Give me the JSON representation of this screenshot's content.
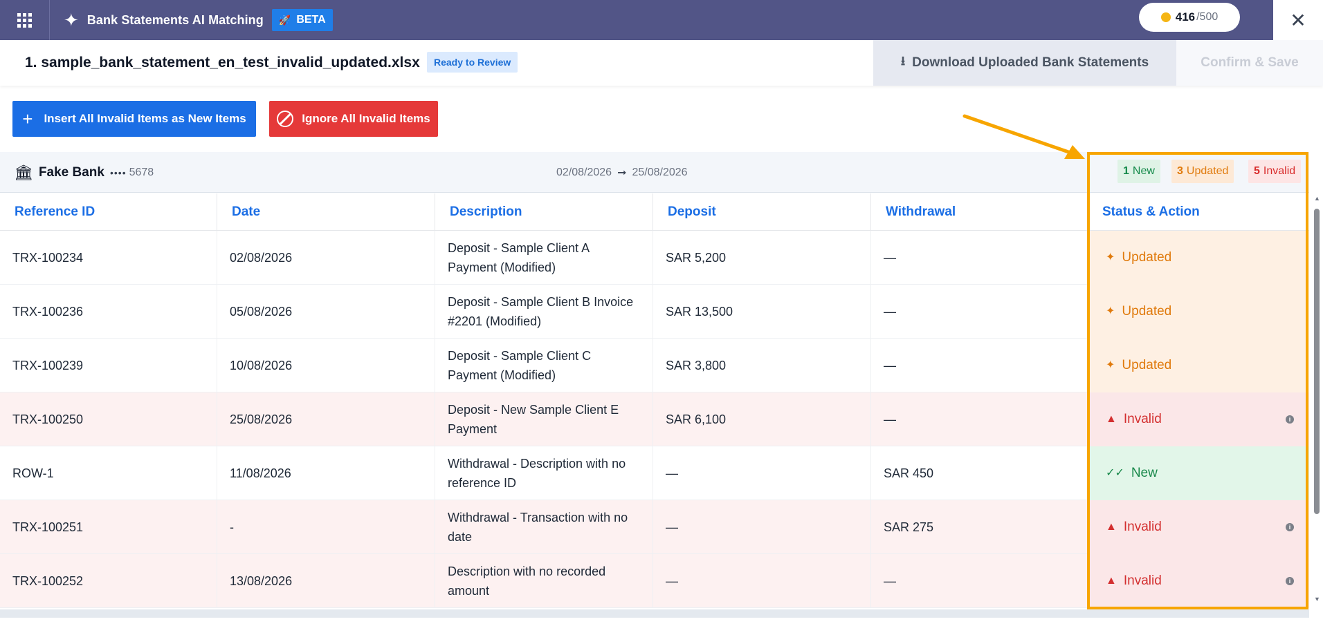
{
  "topbar": {
    "app_title": "Bank Statements AI Matching",
    "beta_label": "BETA",
    "credits_used": "416",
    "credits_total": "/500",
    "apps_icon": "apps-grid-icon",
    "close_icon": "close-icon"
  },
  "file_header": {
    "file_name": "1. sample_bank_statement_en_test_invalid_updated.xlsx",
    "status_badge": "Ready to Review",
    "download_label": "Download Uploaded Bank Statements",
    "confirm_label": "Confirm & Save"
  },
  "actions": {
    "insert_label": "Insert All Invalid Items as New Items",
    "ignore_label": "Ignore All Invalid Items"
  },
  "bank": {
    "name": "Fake Bank",
    "dots": "••••",
    "account": "5678",
    "date_from": "02/08/2026",
    "date_to": "25/08/2026",
    "new_count": "1",
    "new_label": "New",
    "updated_count": "3",
    "updated_label": "Updated",
    "invalid_count": "5",
    "invalid_label": "Invalid"
  },
  "table": {
    "headers": [
      "Reference ID",
      "Date",
      "Description",
      "Deposit",
      "Withdrawal",
      "Status & Action"
    ],
    "rows": [
      {
        "ref": "TRX-100234",
        "date": "02/08/2026",
        "desc": "Deposit - Sample Client A Payment (Modified)",
        "deposit": "SAR 5,200",
        "withdrawal": "—",
        "status": "Updated"
      },
      {
        "ref": "TRX-100236",
        "date": "05/08/2026",
        "desc": "Deposit - Sample Client B Invoice #2201 (Modified)",
        "deposit": "SAR 13,500",
        "withdrawal": "—",
        "status": "Updated"
      },
      {
        "ref": "TRX-100239",
        "date": "10/08/2026",
        "desc": "Deposit - Sample Client C Payment (Modified)",
        "deposit": "SAR 3,800",
        "withdrawal": "—",
        "status": "Updated"
      },
      {
        "ref": "TRX-100250",
        "date": "25/08/2026",
        "desc": "Deposit - New Sample Client E Payment",
        "deposit": "SAR 6,100",
        "withdrawal": "—",
        "status": "Invalid"
      },
      {
        "ref": "ROW-1",
        "date": "11/08/2026",
        "desc": "Withdrawal - Description with no reference ID",
        "deposit": "—",
        "withdrawal": "SAR 450",
        "status": "New"
      },
      {
        "ref": "TRX-100251",
        "date": "-",
        "desc": "Withdrawal - Transaction with no date",
        "deposit": "—",
        "withdrawal": "SAR 275",
        "status": "Invalid"
      },
      {
        "ref": "TRX-100252",
        "date": "13/08/2026",
        "desc": "Description with no recorded amount",
        "deposit": "—",
        "withdrawal": "—",
        "status": "Invalid"
      }
    ]
  },
  "colors": {
    "topbar_bg": "#525587",
    "primary_blue": "#1b6ee5",
    "danger_red": "#e53939",
    "updated_orange": "#e07a0c",
    "invalid_red": "#d32f2f",
    "new_green": "#18884a",
    "highlight": "#f7a500"
  }
}
